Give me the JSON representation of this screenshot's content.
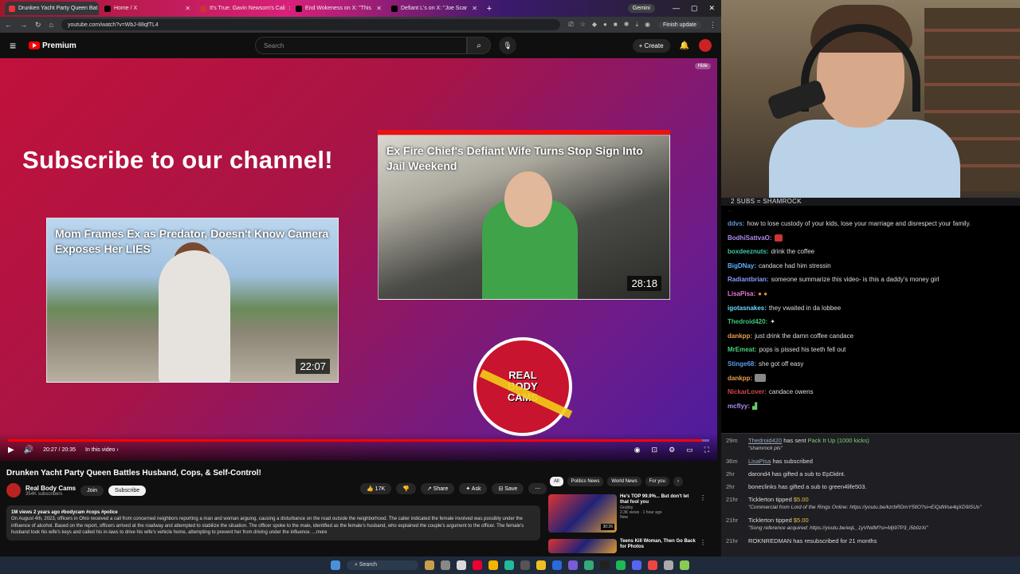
{
  "browser": {
    "tabs": [
      {
        "label": "Drunken Yacht Party Queen Bat",
        "active": true
      },
      {
        "label": "Home / X",
        "active": false
      },
      {
        "label": "It's True: Gavin Newsom's Cali",
        "active": false
      },
      {
        "label": "End Wokeness on X: \"This",
        "active": false
      },
      {
        "label": "Defiant L's on X: \"Joe Scar",
        "active": false
      }
    ],
    "gemini": "Gemini",
    "url": "youtube.com/watch?v=WbJ-88qfTL4",
    "finish_update": "Finish update"
  },
  "youtube": {
    "logo": "Premium",
    "search_placeholder": "Search",
    "create": "+ Create"
  },
  "video": {
    "hide": "Hide",
    "subscribe_text": "Subscribe to our channel!",
    "card1": {
      "title": "Mom Frames Ex as Predator, Doesn't Know Camera Exposes Her LIES",
      "duration": "22:07"
    },
    "card2": {
      "title": "Ex Fire Chief's Defiant Wife Turns Stop Sign Into Jail Weekend",
      "duration": "28:18"
    },
    "badge": [
      "REAL",
      "BODY",
      "CAMS"
    ],
    "time": "20:27 / 20:35",
    "in_this_video": "In this video ›",
    "progress": 0.99
  },
  "details": {
    "title": "Drunken Yacht Party Queen Battles Husband, Cops, & Self-Control!",
    "channel": "Real Body Cams",
    "subscribers": "354K subscribers",
    "join": "Join",
    "subscribe": "Subscribe",
    "likes": "17K",
    "share": "Share",
    "ask": "Ask",
    "save": "Save",
    "desc_meta": "1M views  2 years ago  #bodycam #cops #police",
    "desc_text": "On August 4th, 2023, officers in Ohio received a call from concerned neighbors reporting a man and woman arguing, causing a disturbance on the road outside the neighborhood. The caller indicated the female involved was possibly under the influence of alcohol. Based on the report, officers arrived at the roadway and attempted to stabilize the situation. The officer spoke to the male, identified as the female's husband, who explained the couple's argument to the officer. The female's husband took his wife's keys and called his in-laws to drive his wife's vehicle home, attempting to prevent her from driving under the influence. ...more",
    "chips": [
      "All",
      "Politics News",
      "World News",
      "For you"
    ],
    "recs": [
      {
        "title": "He's TOP 99.9%... But don't let that fool you",
        "channel": "Grubby",
        "meta": "2.3K views · 1 hour ago",
        "tag": "New",
        "duration": "30:26"
      },
      {
        "title": "Teens Kill Woman, Then Go Back for Photos",
        "channel": "",
        "meta": "",
        "tag": "",
        "duration": ""
      }
    ]
  },
  "taskbar": {
    "search": "Search"
  },
  "stream": {
    "header": "2 SUBS = SHAMROCK",
    "chat": [
      {
        "user": "ddvs:",
        "color": "#5b9bd5",
        "text": "how to lose custody of your kids, lose your marriage and disrespect your family."
      },
      {
        "user": "BodhiSattvaO:",
        "color": "#b08cf0",
        "text": ""
      },
      {
        "user": "boxdeeznuts:",
        "color": "#3ec7a6",
        "text": "drink the coffee"
      },
      {
        "user": "BigDNay:",
        "color": "#5fb4ff",
        "text": "candace had him stressin"
      },
      {
        "user": "Radiantbrian:",
        "color": "#8a9cff",
        "text": "someone summarize this video- is this a daddy's money girl"
      },
      {
        "user": "LisaPisa:",
        "color": "#e879d6",
        "text": ""
      },
      {
        "user": "igotasnakes:",
        "color": "#6fd6ff",
        "text": "they vwaited in da lobbee"
      },
      {
        "user": "Thedroid420:",
        "color": "#3ec77a",
        "text": ""
      },
      {
        "user": "dankpp:",
        "color": "#e7a14a",
        "text": "just drink the damn coffee candace"
      },
      {
        "user": "MrEmeat:",
        "color": "#4ad17a",
        "text": "pops is pissed his teeth fell out"
      },
      {
        "user": "Stinge68:",
        "color": "#5a9cf0",
        "text": "she got off easy"
      },
      {
        "user": "dankpp:",
        "color": "#e7a14a",
        "text": ""
      },
      {
        "user": "NickarLover:",
        "color": "#d04848",
        "text": "candace owens"
      },
      {
        "user": "mcflyy:",
        "color": "#b08cf0",
        "text": ""
      }
    ],
    "events": [
      {
        "time": "29m",
        "user": "Thedroid420",
        "text": "has sent",
        "hl": "Pack It Up (1000 kicks)",
        "quote": "\"shamrock pls\""
      },
      {
        "time": "36m",
        "user": "LisaPisa",
        "text": "has subscribed",
        "hl": "",
        "quote": ""
      },
      {
        "time": "2hr",
        "user": "darond4",
        "text": "has gifted a sub to",
        "hl": "EpDidnt.",
        "quote": ""
      },
      {
        "time": "2hr",
        "user": "boneclinks",
        "text": "has gifted a sub to",
        "hl": "green4life503.",
        "quote": ""
      },
      {
        "time": "21hr",
        "user": "Ticklerton",
        "text": "tipped",
        "hl": "$5.00",
        "quote": "\"Commercial from Lord of the Rings Online: https://youtu.be/kzrbRDmY5tlO?si=EiQdWse4qXD9iSUo\""
      },
      {
        "time": "21hr",
        "user": "Ticklerton",
        "text": "tipped",
        "hl": "$5.00",
        "quote": "\"Song reference acquired: https://youtu.be/eqL_1yVNdM?si=Mji97P3_i5b0zXi\""
      },
      {
        "time": "21hr",
        "user": "ROKNREDMAN",
        "text": "has resubscribed for 21 months",
        "hl": "",
        "quote": ""
      }
    ]
  }
}
